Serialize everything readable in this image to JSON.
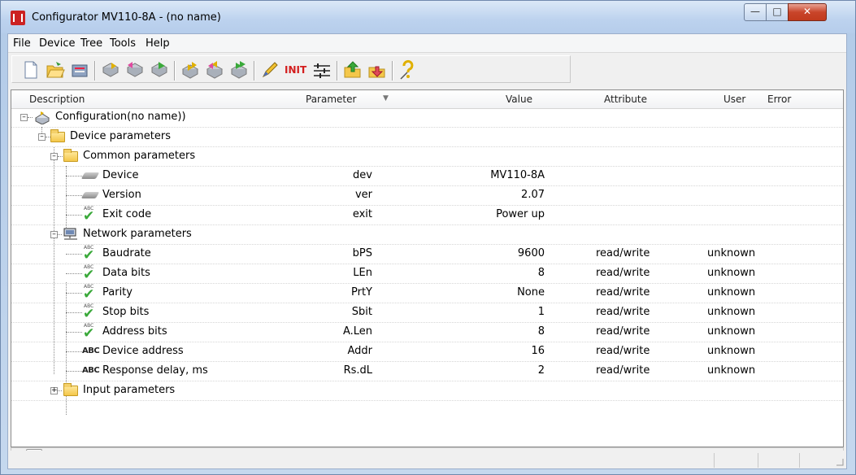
{
  "window": {
    "title": "Configurator MV110-8A - (no name)"
  },
  "menu": [
    "File",
    "Device",
    "Tree",
    "Tools",
    "Help"
  ],
  "toolbar": {
    "init_label": "INIT",
    "buttons": [
      "new-icon",
      "open-icon",
      "device-icon",
      "read-icon",
      "write-icon",
      "compare-icon",
      "read-all-icon",
      "write-all-icon",
      "compare-all-icon",
      "edit-icon",
      "init-icon",
      "settings-icon",
      "upload-icon",
      "download-icon",
      "help-icon"
    ]
  },
  "grid": {
    "columns": [
      "Description",
      "Parameter",
      "Value",
      "Attribute",
      "User",
      "Error"
    ],
    "rows": [
      {
        "description": "Configuration(no name))",
        "parameter": "",
        "value": "",
        "attribute": "",
        "user": ""
      },
      {
        "description": "Device parameters",
        "parameter": "",
        "value": "",
        "attribute": "",
        "user": ""
      },
      {
        "description": "Common parameters",
        "parameter": "",
        "value": "",
        "attribute": "",
        "user": ""
      },
      {
        "description": "Device",
        "parameter": "dev",
        "value": "MV110-8A",
        "attribute": "",
        "user": ""
      },
      {
        "description": "Version",
        "parameter": "ver",
        "value": "2.07",
        "attribute": "",
        "user": ""
      },
      {
        "description": "Exit code",
        "parameter": "exit",
        "value": "Power up",
        "attribute": "",
        "user": ""
      },
      {
        "description": "Network parameters",
        "parameter": "",
        "value": "",
        "attribute": "",
        "user": ""
      },
      {
        "description": "Baudrate",
        "parameter": "bPS",
        "value": "9600",
        "attribute": "read/write",
        "user": "unknown"
      },
      {
        "description": "Data bits",
        "parameter": "LEn",
        "value": "8",
        "attribute": "read/write",
        "user": "unknown"
      },
      {
        "description": "Parity",
        "parameter": "PrtY",
        "value": "None",
        "attribute": "read/write",
        "user": "unknown"
      },
      {
        "description": "Stop bits",
        "parameter": "Sbit",
        "value": "1",
        "attribute": "read/write",
        "user": "unknown"
      },
      {
        "description": "Address bits",
        "parameter": "A.Len",
        "value": "8",
        "attribute": "read/write",
        "user": "unknown"
      },
      {
        "description": "Device address",
        "parameter": "Addr",
        "value": "16",
        "attribute": "read/write",
        "user": "unknown"
      },
      {
        "description": "Response delay, ms",
        "parameter": "Rs.dL",
        "value": "2",
        "attribute": "read/write",
        "user": "unknown"
      },
      {
        "description": "Input parameters",
        "parameter": "",
        "value": "",
        "attribute": "",
        "user": ""
      }
    ]
  },
  "icons": {
    "abc_small": "ABC",
    "abc_big": "ABC"
  }
}
